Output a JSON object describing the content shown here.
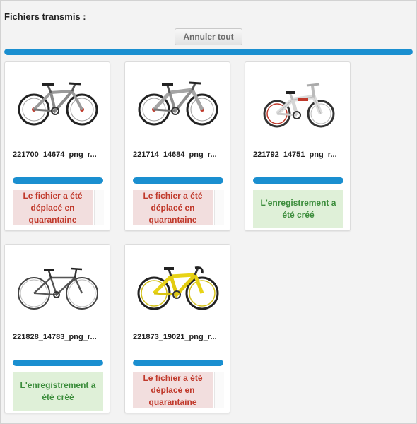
{
  "header": {
    "title": "Fichiers transmis :"
  },
  "toolbar": {
    "cancel_all_label": "Annuler tout"
  },
  "global_progress": {
    "percent": 100
  },
  "colors": {
    "progress": "#1a8fd0",
    "error_bg": "#f2dede",
    "error_text": "#c0392b",
    "success_bg": "#dff0d8",
    "success_text": "#3c8d3c"
  },
  "files": [
    {
      "name": "221700_14674_png_r...",
      "progress": 100,
      "status": "Le fichier a été déplacé en quarantaine",
      "status_type": "error",
      "thumbnail": "mountain-bike-gray-icon"
    },
    {
      "name": "221714_14684_png_r...",
      "progress": 100,
      "status": "Le fichier a été déplacé en quarantaine",
      "status_type": "error",
      "thumbnail": "mountain-bike-gray-icon"
    },
    {
      "name": "221792_14751_png_r...",
      "progress": 100,
      "status": "L'enregistrement a été créé",
      "status_type": "success",
      "thumbnail": "bmx-bike-white-icon"
    },
    {
      "name": "221828_14783_png_r...",
      "progress": 100,
      "status": "L'enregistrement a été créé",
      "status_type": "success",
      "thumbnail": "city-bike-black-icon"
    },
    {
      "name": "221873_19021_png_r...",
      "progress": 100,
      "status": "Le fichier a été déplacé en quarantaine",
      "status_type": "error",
      "thumbnail": "road-bike-yellow-icon"
    }
  ]
}
